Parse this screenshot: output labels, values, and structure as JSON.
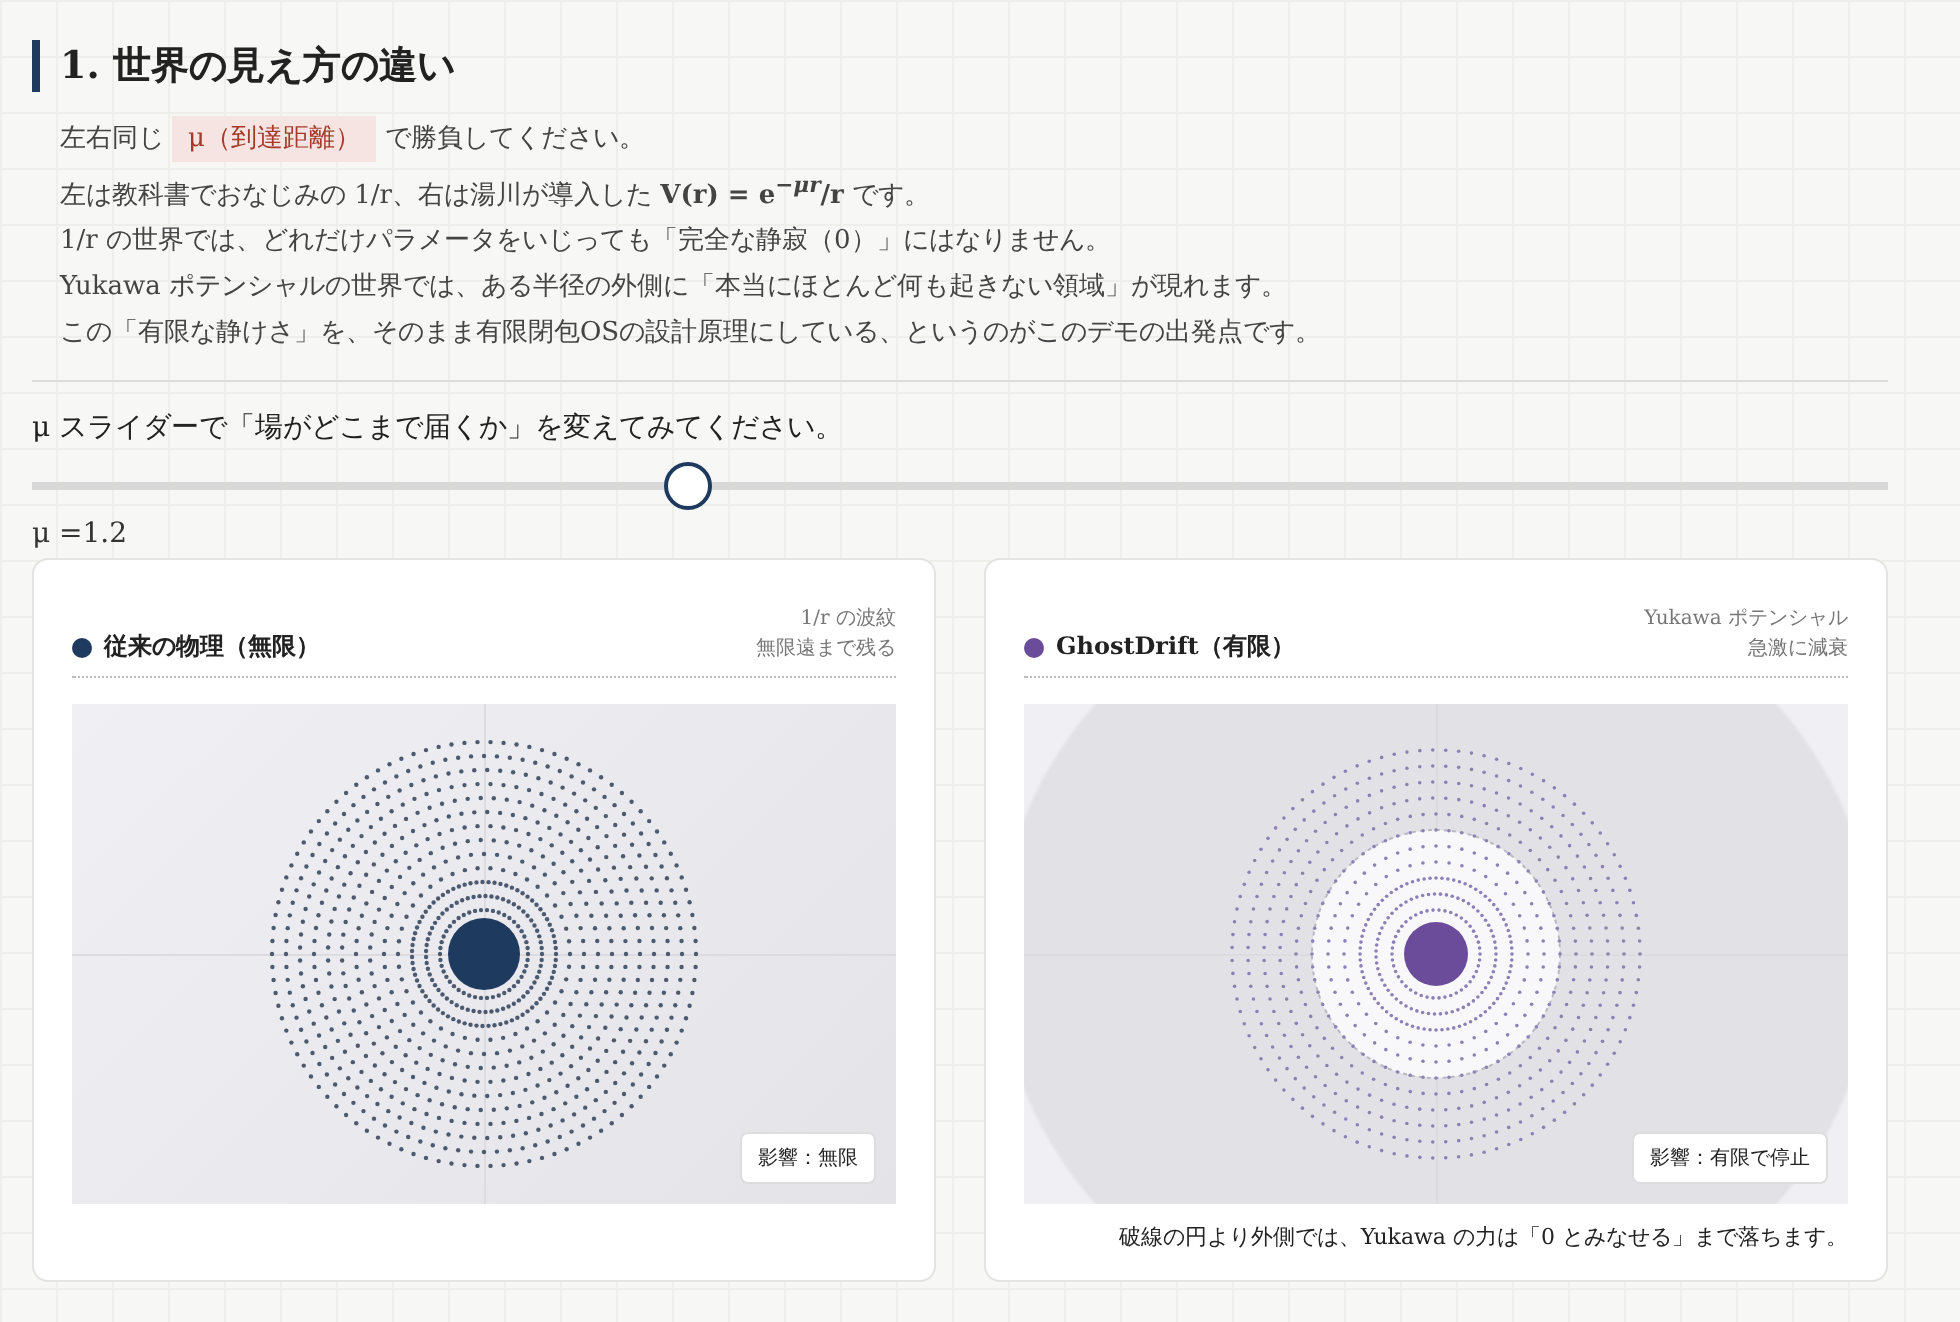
{
  "section": {
    "title": "1. 世界の見え方の違い"
  },
  "intro": {
    "line1_before": "左右同じ",
    "line1_chip": "μ（到達距離）",
    "line1_after": "で勝負してください。",
    "lines": [
      "左は教科書でおなじみの 1/r、右は湯川が導入した **V(r) = e**$^{−μr}$**/r** です。",
      "1/r の世界では、どれだけパラメータをいじっても「完全な静寂（0）」にはなりません。",
      "Yukawa ポテンシャルの世界では、ある半径の外側に「本当にほとんど何も起きない領域」が現れます。",
      "この「有限な静けさ」を、そのまま有限閉包OSの設計原理にしている、というのがこのデモの出発点です。"
    ]
  },
  "slider": {
    "prompt": "μ スライダーで「場がどこまで届くか」を変えてみてください。",
    "level": 0.353,
    "reading": "μ =1.2"
  },
  "cards": [
    {
      "kind": "infinite",
      "title": "従来の物理（無限）",
      "color": "#1e3a5f",
      "note": [
        "1/r の波紋",
        "無限遠まで残る"
      ],
      "badge": "影響：無限"
    },
    {
      "kind": "finite",
      "title": "GhostDrift（有限）",
      "color": "#6b4c9a",
      "note": [
        "Yukawa ポテンシャル",
        "急激に減衰"
      ],
      "badge": "影響：有限で停止",
      "caption": "破線の円より外側では、Yukawa の力は「0 とみなせる」まで落ちます。"
    }
  ]
}
